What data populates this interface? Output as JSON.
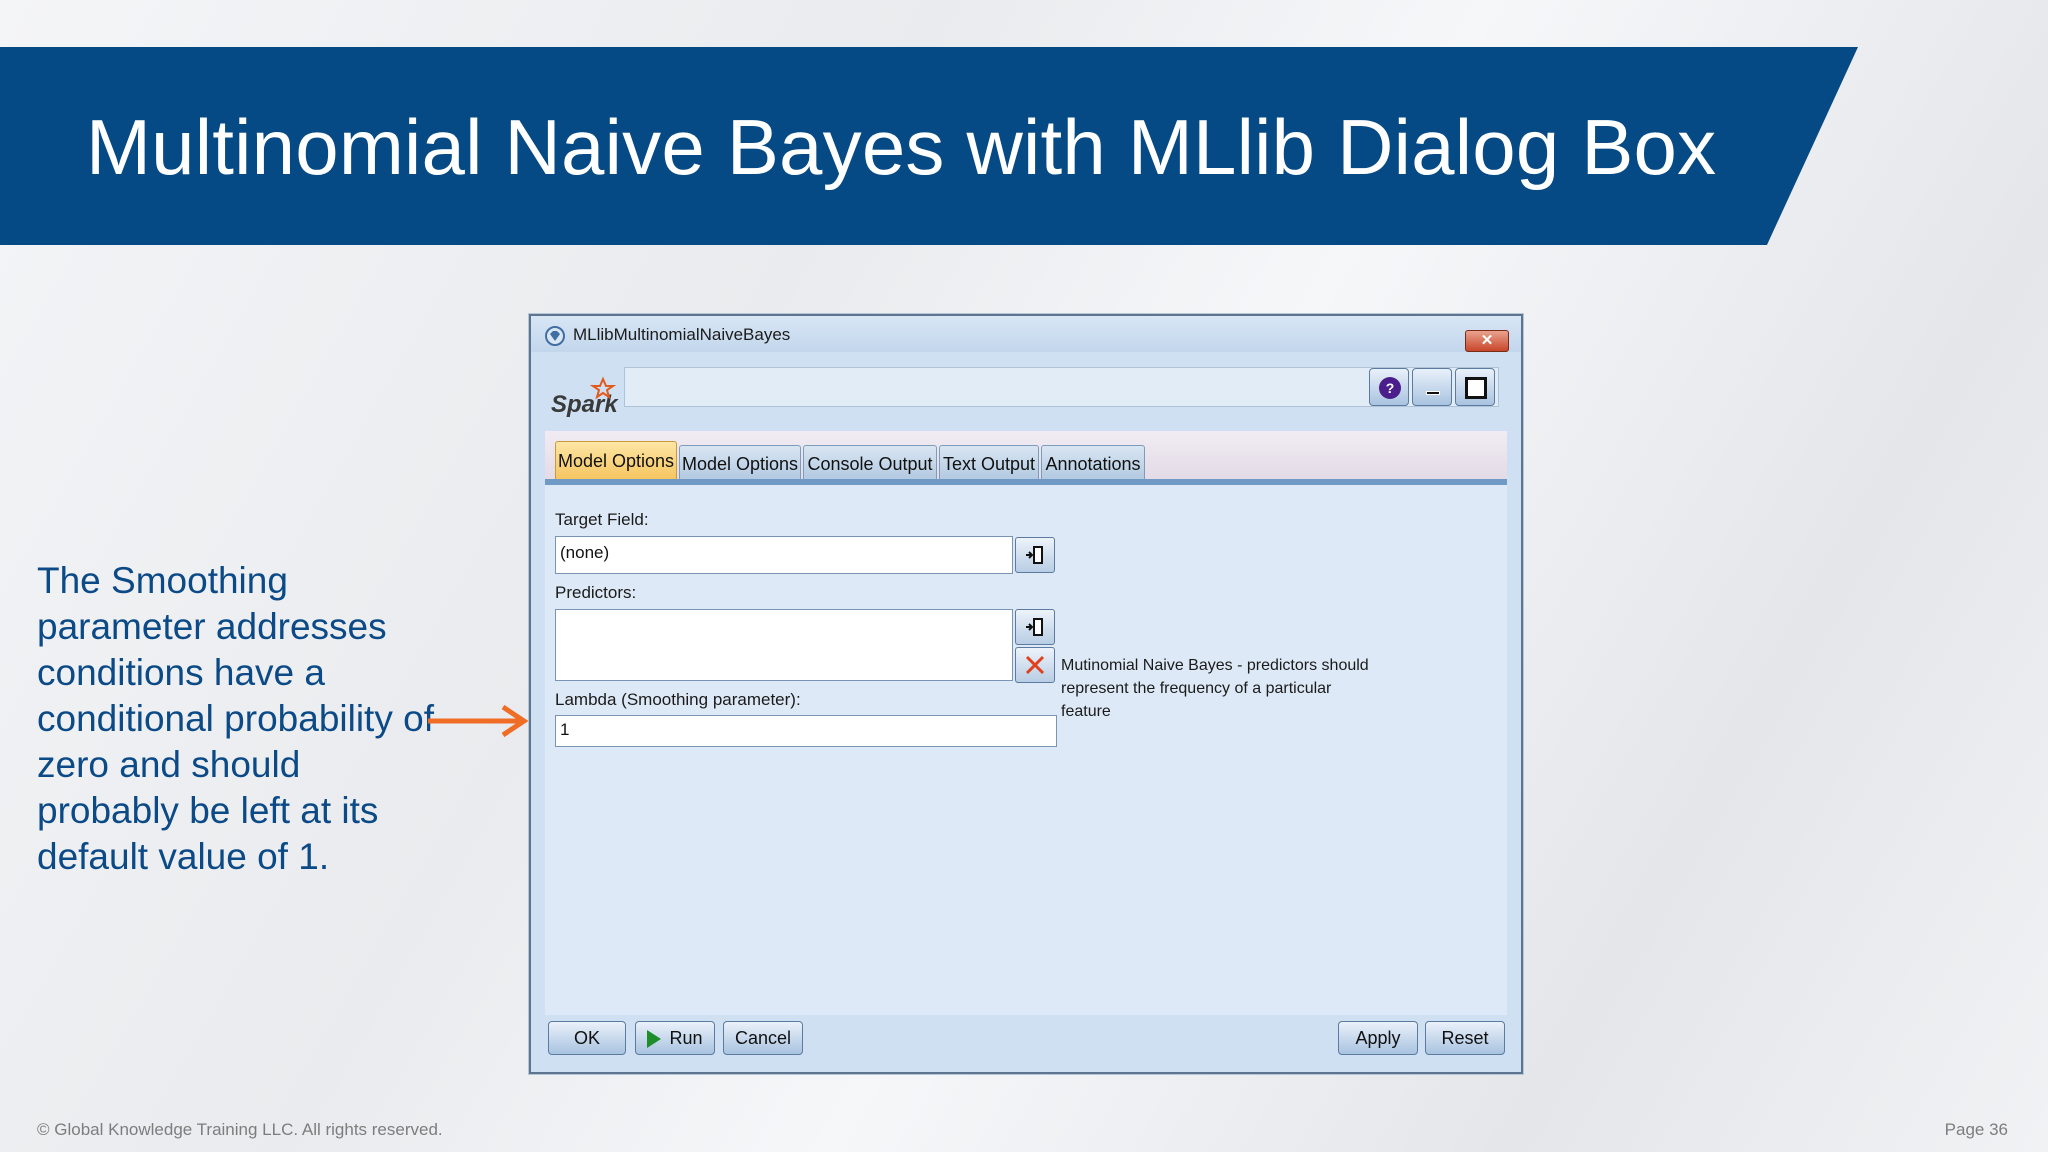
{
  "slide": {
    "title": "Multinomial Naive Bayes with MLlib Dialog Box",
    "callout": "The Smoothing parameter addresses conditions have a conditional probability of zero and should probably be left at its default value of 1.",
    "copyright": "© Global Knowledge Training LLC. All rights reserved.",
    "page": "Page 36",
    "accent_color": "#054a85",
    "arrow_color": "#f06d26"
  },
  "dialog": {
    "title": "MLlibMultinomialNaiveBayes",
    "close_label": "✕",
    "logo_text": "Spark",
    "help_label": "?",
    "tabs": [
      {
        "label": "Model Options"
      },
      {
        "label": "Model Options"
      },
      {
        "label": "Console Output"
      },
      {
        "label": "Text Output"
      },
      {
        "label": "Annotations"
      }
    ],
    "target_label": "Target Field:",
    "target_value": "(none)",
    "predictors_label": "Predictors:",
    "lambda_label": "Lambda (Smoothing parameter):",
    "lambda_value": "1",
    "description": "Mutinomial Naive Bayes - predictors should represent the frequency of a particular feature",
    "buttons": {
      "ok": "OK",
      "run": "Run",
      "cancel": "Cancel",
      "apply": "Apply",
      "reset": "Reset"
    }
  }
}
